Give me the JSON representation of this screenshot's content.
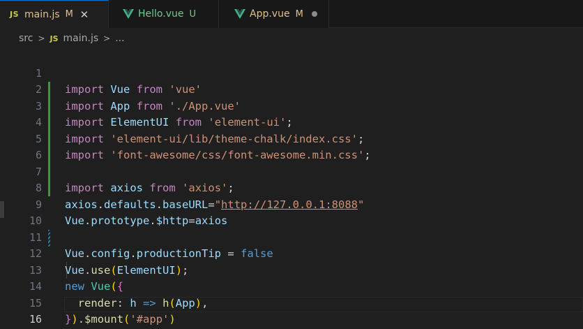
{
  "tabs": [
    {
      "icon": "JS",
      "label": "main.js",
      "status": "M",
      "active": true
    },
    {
      "label": "Hello.vue",
      "status": "U"
    },
    {
      "label": "App.vue",
      "status": "M"
    }
  ],
  "breadcrumb": {
    "folder": "src",
    "file_icon": "JS",
    "file": "main.js",
    "more": "..."
  },
  "colors": {
    "keyword": "#c586c0",
    "keyword_blue": "#569cd6",
    "variable": "#9cdcfe",
    "string": "#ce9178",
    "function": "#dcdcaa",
    "git_added": "#2ea043",
    "git_modified": "#1b81a8"
  },
  "code": {
    "lines": [
      "import Vue from 'vue'",
      "import App from './App.vue'",
      "import ElementUI from 'element-ui';",
      "import 'element-ui/lib/theme-chalk/index.css';",
      "import 'font-awesome/css/font-awesome.min.css';",
      "",
      "import axios from 'axios';",
      "axios.defaults.baseURL=\"http://127.0.0.1:8088\"",
      "Vue.prototype.$http=axios",
      "",
      "Vue.config.productionTip = false",
      "Vue.use(ElementUI);",
      "new Vue({",
      "  render: h => h(App),",
      "}).$mount('#app')",
      ""
    ],
    "line_numbers": [
      "1",
      "2",
      "3",
      "4",
      "5",
      "6",
      "7",
      "8",
      "9",
      "10",
      "11",
      "12",
      "13",
      "14",
      "15",
      "16"
    ],
    "current_line": 16,
    "added_lines": [
      3,
      9
    ],
    "modified_lines": [
      12
    ]
  }
}
